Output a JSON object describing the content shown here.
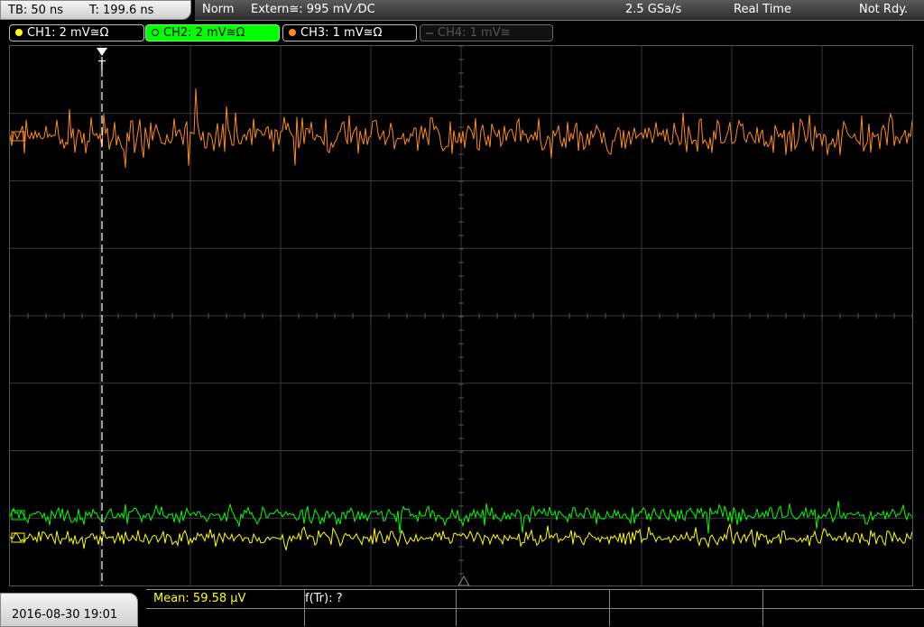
{
  "header": {
    "timebase": "TB: 50 ns",
    "trigger_time": "T: 199.6 ns",
    "mode": "Norm",
    "trigger_source": "Extern≅: 995 mV ⁄DC",
    "sample_rate": "2.5 GSa/s",
    "acq_mode": "Real Time",
    "status": "Not Rdy."
  },
  "channels": [
    {
      "label": "CH1: 2 mV≅Ω",
      "color": "#ffff00",
      "active": false
    },
    {
      "label": "CH2: 2 mV≅Ω",
      "color": "#00ff00",
      "active": true
    },
    {
      "label": "CH3: 1 mV≅Ω",
      "color": "#ff8c1a",
      "active": false
    },
    {
      "label": "CH4: 1 mV≅",
      "color": "#555555",
      "active": false
    }
  ],
  "footer": {
    "datetime": "2016-08-30 19:01",
    "measurement_mean": "Mean: 59.58 µV",
    "measurement_ftr": "f(Tr): ?"
  },
  "trigger_marker": "T",
  "colors": {
    "ch1": "#ffff00",
    "ch2": "#00ff00",
    "ch3": "#ff8c1a",
    "grid": "#3a3a3a",
    "background": "#000000"
  }
}
